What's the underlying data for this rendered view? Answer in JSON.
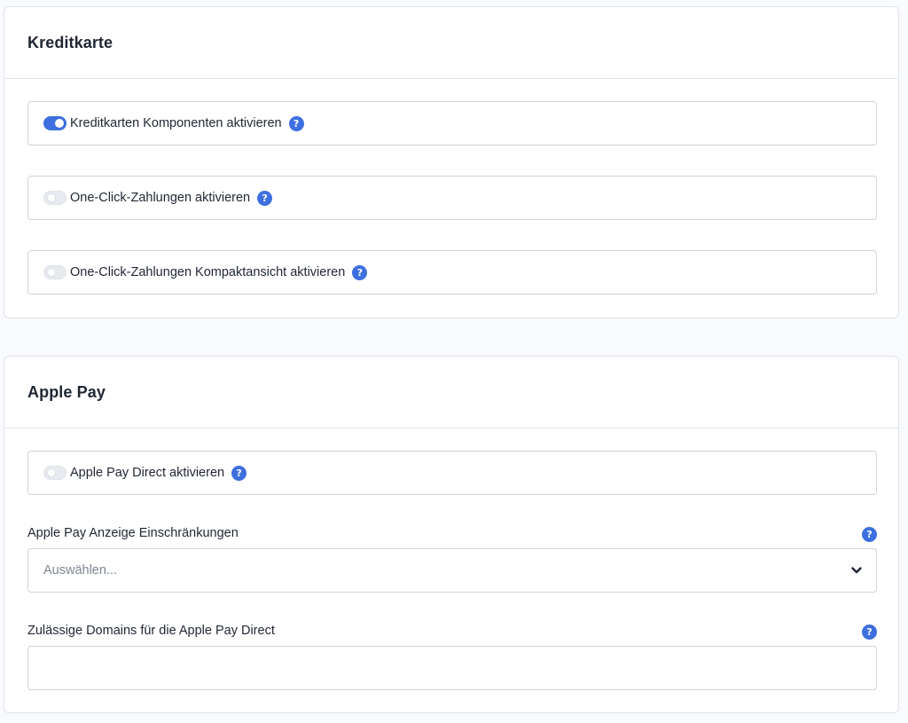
{
  "kreditkarte": {
    "title": "Kreditkarte",
    "options": [
      {
        "label": "Kreditkarten Komponenten aktivieren",
        "enabled": true
      },
      {
        "label": "One-Click-Zahlungen aktivieren",
        "enabled": false
      },
      {
        "label": "One-Click-Zahlungen Kompaktansicht aktivieren",
        "enabled": false
      }
    ]
  },
  "applepay": {
    "title": "Apple Pay",
    "direct_option": {
      "label": "Apple Pay Direct aktivieren",
      "enabled": false
    },
    "restrictions": {
      "label": "Apple Pay Anzeige Einschränkungen",
      "placeholder": "Auswählen..."
    },
    "domains": {
      "label": "Zulässige Domains für die Apple Pay Direct",
      "value": ""
    }
  },
  "help_glyph": "?",
  "colors": {
    "accent": "#3d6fe0",
    "border": "#cdd3dc"
  }
}
